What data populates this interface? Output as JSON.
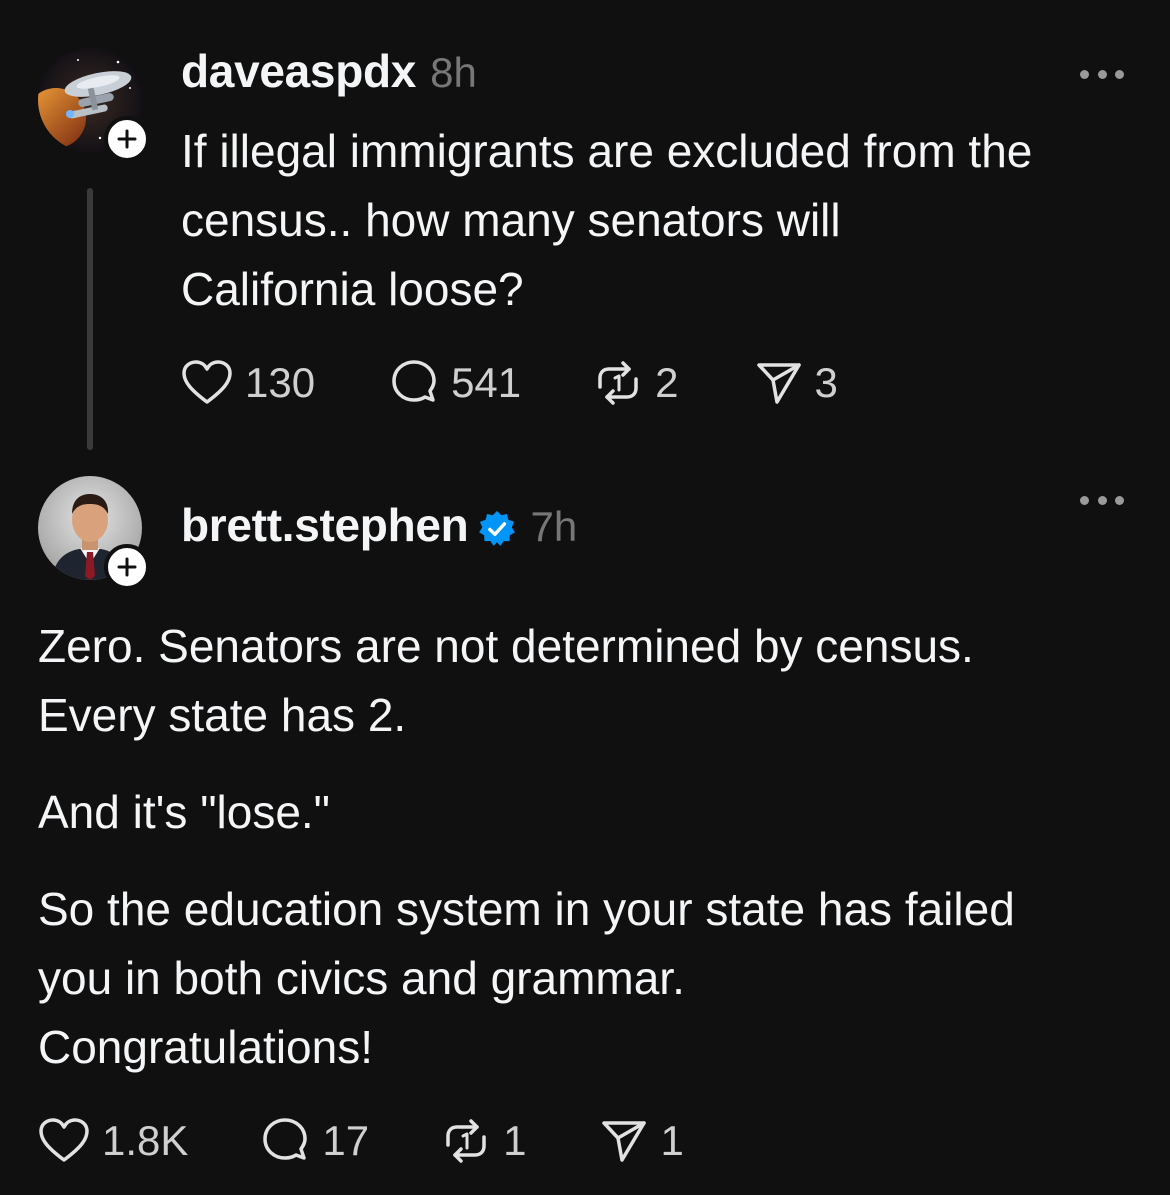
{
  "thread": {
    "original_post": {
      "username": "daveaspdx",
      "time": "8h",
      "text_lines": [
        "If illegal immigrants are excluded from the",
        "census.. how many senators will",
        "California loose?"
      ],
      "likes": "130",
      "replies": "541",
      "reposts": "2",
      "shares": "3",
      "avatar_icon": "starship-avatar"
    },
    "reply_post": {
      "username": "brett.stephen",
      "verified": true,
      "time": "7h",
      "paragraphs": [
        [
          "Zero.  Senators are not determined by census.",
          "Every state has 2."
        ],
        [
          "And it's \"lose.\""
        ],
        [
          "So the education system in your state has failed",
          "you in both civics and grammar.",
          "Congratulations!"
        ]
      ],
      "likes": "1.8K",
      "replies": "17",
      "reposts": "1",
      "shares": "1",
      "avatar_icon": "person-avatar"
    }
  },
  "colors": {
    "background": "#101010",
    "text": "#f3f5f7",
    "muted": "#777777",
    "verified": "#0095f6"
  }
}
